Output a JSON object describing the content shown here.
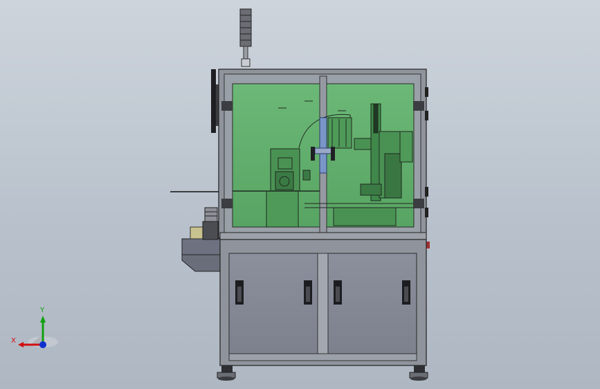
{
  "viewport": {
    "background_top": "#cdd4dc",
    "background_bottom": "#aeb7c2",
    "view": "front"
  },
  "model": {
    "frame_color": "#8f949c",
    "glass_color": "#5fae6a",
    "cabinet_color": "#858894",
    "dark_color": "#2a2c30",
    "transparent_element": "blue-rod"
  },
  "triad": {
    "x_label": "X",
    "y_label": "Y",
    "x_color": "#d01010",
    "y_color": "#10a010",
    "z_color": "#1030d0"
  }
}
